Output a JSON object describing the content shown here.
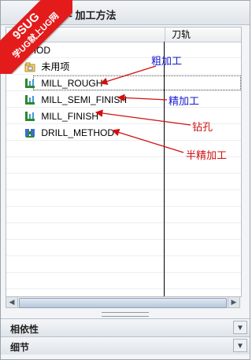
{
  "window": {
    "title": "导航器 - 加工方法",
    "watermark_line1": "9SUG",
    "watermark_line2": "学UG就上UG网"
  },
  "columns": {
    "name": "",
    "toolpath": "刀轨"
  },
  "tree": {
    "root": "METHOD",
    "items": [
      {
        "label": "未用项",
        "icon": "unused-folder-icon"
      },
      {
        "label": "MILL_ROUGH",
        "icon": "mill-method-icon"
      },
      {
        "label": "MILL_SEMI_FINISH",
        "icon": "mill-method-icon"
      },
      {
        "label": "MILL_FINISH",
        "icon": "mill-method-icon"
      },
      {
        "label": "DRILL_METHOD",
        "icon": "drill-method-icon"
      }
    ]
  },
  "annotations": {
    "rough": "粗加工",
    "semi_finish": "精加工",
    "finish": "钻孔",
    "drill": "半精加工"
  },
  "sections": {
    "dependencies": "相依性",
    "details": "细节"
  },
  "colors": {
    "annotation_blue": "#1a1ad0",
    "annotation_red": "#d01010",
    "watermark": "#e31b1b"
  }
}
